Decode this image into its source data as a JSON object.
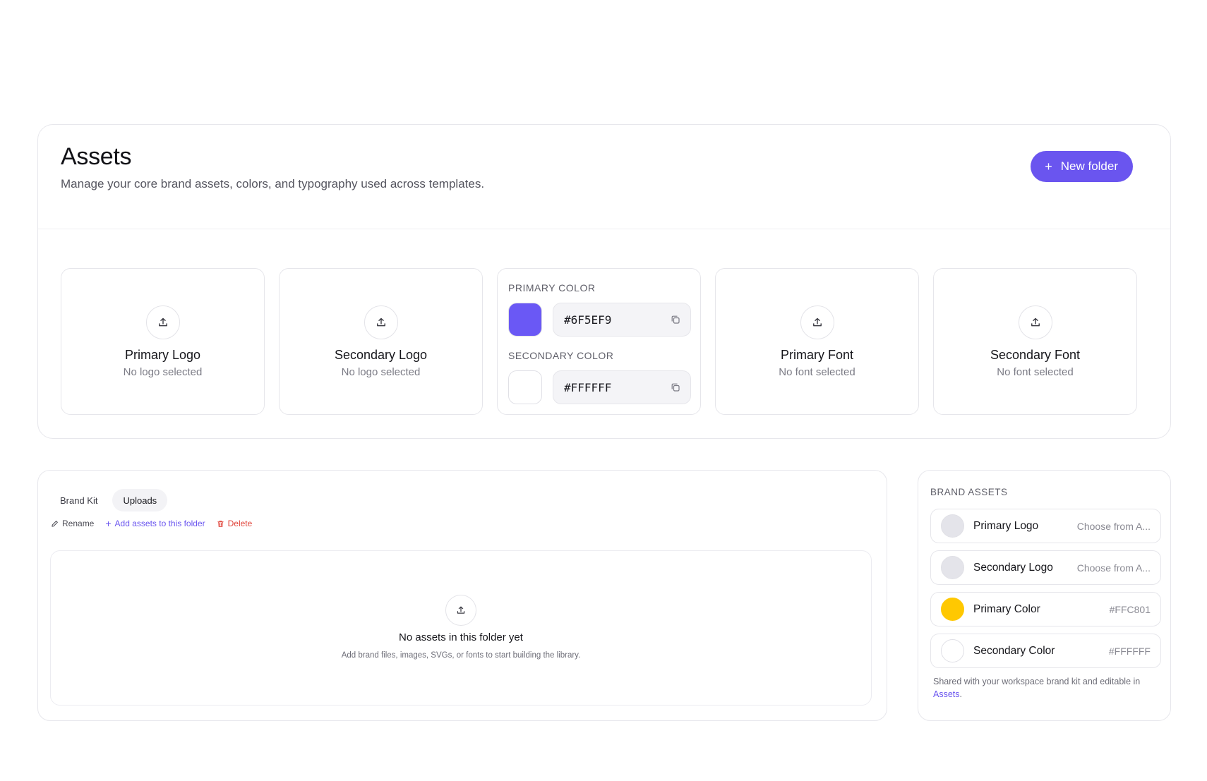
{
  "header": {
    "title": "Assets",
    "subtitle": "Manage your core brand assets, colors, and typography used across templates.",
    "new_folder_label": "New folder"
  },
  "tiles": {
    "primary_logo": {
      "title": "Primary Logo",
      "status": "No logo selected"
    },
    "secondary_logo": {
      "title": "Secondary Logo",
      "status": "No logo selected"
    },
    "colors": {
      "primary_label": "PRIMARY COLOR",
      "primary_hex": "#6F5EF9",
      "primary_swatch": "#6a58f5",
      "secondary_label": "SECONDARY COLOR",
      "secondary_hex": "#FFFFFF",
      "secondary_swatch": "#ffffff"
    },
    "primary_font": {
      "title": "Primary Font",
      "status": "No font selected"
    },
    "secondary_font": {
      "title": "Secondary Font",
      "status": "No font selected"
    }
  },
  "folder": {
    "tabs": [
      {
        "label": "Brand Kit",
        "active": false
      },
      {
        "label": "Uploads",
        "active": true
      }
    ],
    "actions": {
      "rename": "Rename",
      "add": "Add assets to this folder",
      "delete": "Delete"
    },
    "empty": {
      "title": "No assets in this folder yet",
      "subtitle": "Add brand files, images, SVGs, or fonts to start building the library."
    }
  },
  "brand_assets": {
    "heading": "BRAND ASSETS",
    "items": [
      {
        "name": "Primary Logo",
        "value": "Choose from A...",
        "dot": "#e4e4ea"
      },
      {
        "name": "Secondary Logo",
        "value": "Choose from A...",
        "dot": "#e4e4ea"
      },
      {
        "name": "Primary Color",
        "value": "#FFC801",
        "dot": "#FFC801"
      },
      {
        "name": "Secondary Color",
        "value": "#FFFFFF",
        "dot": "#FFFFFF"
      }
    ],
    "footer_text": "Shared with your workspace brand kit and editable in",
    "footer_link": "Assets",
    "footer_end": "."
  },
  "colors": {
    "accent": "#6a55ef",
    "danger": "#e0443a"
  },
  "icons": {
    "upload": "upload-icon",
    "copy": "copy-icon",
    "pencil": "pencil-icon",
    "plus": "plus-icon",
    "trash": "trash-icon"
  }
}
